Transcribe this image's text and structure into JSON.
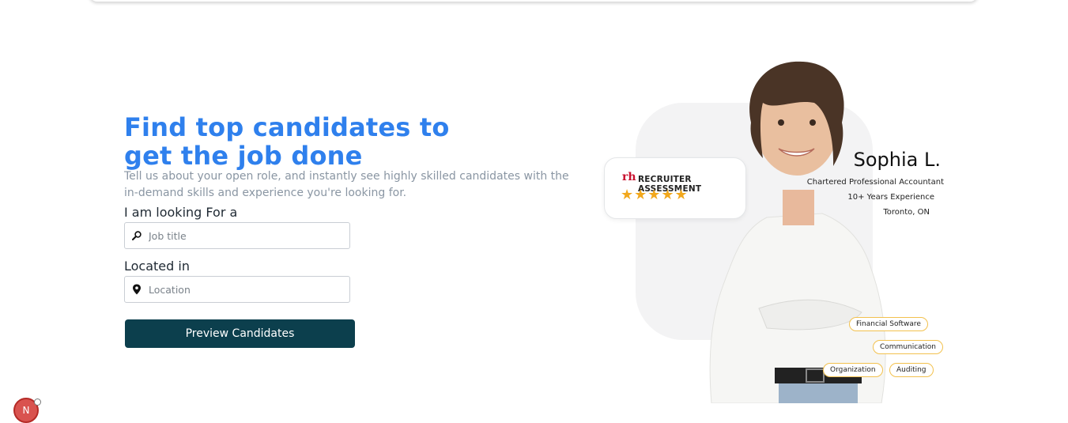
{
  "hero": {
    "headline": "Find top candidates to get the job done",
    "subtitle": "Tell us about your open role, and instantly see highly skilled candidates with the in-demand skills and experience you're looking for."
  },
  "form": {
    "job_label": "I am looking For a",
    "job_placeholder": "Job title",
    "location_label": "Located in",
    "location_placeholder": "Location",
    "submit_label": "Preview Candidates"
  },
  "profile_card": {
    "logo": "rh",
    "assessment_label": "RECRUITER ASSESSMENT",
    "stars": "★★★★★",
    "rating": 5,
    "name": "Sophia L.",
    "title": "Chartered Professional  Accountant",
    "experience": "10+ Years Experience",
    "location": "Toronto, ON",
    "skills": [
      "Financial Software",
      "Communication",
      "Organization",
      "Auditing"
    ]
  },
  "badge": {
    "letter": "N"
  },
  "colors": {
    "headline": "#2f80ed",
    "button": "#0c3f4d",
    "star": "#f2a81d",
    "pill_border": "#f2c14e"
  },
  "icons": {
    "job": "search-icon",
    "location": "map-pin-icon"
  }
}
